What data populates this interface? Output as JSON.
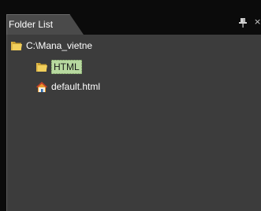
{
  "panel": {
    "tab_label": "Folder List",
    "pin_icon": "pin-icon",
    "close_icon": "close-icon",
    "close_glyph": "×"
  },
  "tree": {
    "root": {
      "label": "C:\\Mana_vietne",
      "icon": "folder-open-icon"
    },
    "children": [
      {
        "label": "HTML",
        "icon": "folder-icon",
        "selected": true
      },
      {
        "label": "default.html",
        "icon": "home-page-icon",
        "selected": false
      }
    ]
  },
  "colors": {
    "panel_bg": "#3c3c3c",
    "tab_bg": "#4a4a4a",
    "selection_bg": "#b8d9a0",
    "folder_yellow": "#e8c24a"
  }
}
